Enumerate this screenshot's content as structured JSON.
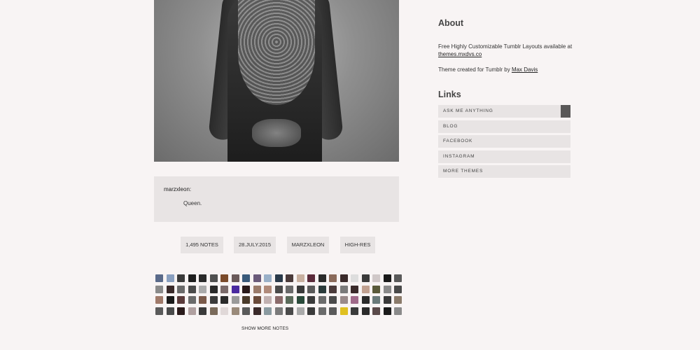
{
  "post": {
    "quote_user": "marzxleon:",
    "quote_text": "Queen."
  },
  "meta": {
    "notes": "1,495 NOTES",
    "date": "28.JULY.2015",
    "source": "MARZXLEON",
    "highres": "HIGH-RES"
  },
  "notes_section": {
    "show_more": "SHOW MORE NOTES",
    "avatar_colors": [
      "#5a6a8a",
      "#8aa0c0",
      "#3a3a3a",
      "#1e1e1e",
      "#2a2a2a",
      "#505050",
      "#7a4a2a",
      "#6a5a5a",
      "#3a5a7a",
      "#6a5a7a",
      "#9ab0c8",
      "#2a3a4a",
      "#4a3a3a",
      "#c8b0a0",
      "#5a2a3a",
      "#2a2a2a",
      "#8a6a5a",
      "#3a2a2a",
      "#dddddd",
      "#3a3a3a",
      "#d0c8c8",
      "#1a1a1a",
      "#5a5a5a",
      "#8a8a8a",
      "#3a2a2a",
      "#6a6a6a",
      "#4a4a4a",
      "#aaaaaa",
      "#2a2a2a",
      "#7a6a6a",
      "#4a2aa0",
      "#2a1a1a",
      "#9a7a6a",
      "#b08a7a",
      "#4a4a4a",
      "#6a6a6a",
      "#3a3a3a",
      "#5a5a5a",
      "#2a3a3a",
      "#4a3a3a",
      "#7a7a7a",
      "#3a2a2a",
      "#c0a090",
      "#5a5a3a",
      "#8a8a8a",
      "#4a4a4a",
      "#a07a6a",
      "#1a1a1a",
      "#5a3a3a",
      "#6a6a6a",
      "#7a5a4a",
      "#3a3a3a",
      "#2a2a2a",
      "#9a9a9a",
      "#4a3a2a",
      "#6a4a3a",
      "#c0b0b0",
      "#8a6a6a",
      "#5a6a5a",
      "#2a4a3a",
      "#3a3a3a",
      "#6a6a6a",
      "#4a4a4a",
      "#9a8a8a",
      "#a06a8a",
      "#2a2a2a",
      "#6a7a7a",
      "#3a3a3a",
      "#8a7a6a",
      "#5a5a5a",
      "#4a4a4a",
      "#2a1a1a",
      "#b0a0a0",
      "#3a3a3a",
      "#7a6a5a",
      "#e0d8d8",
      "#9a8a7a",
      "#5a5a5a",
      "#3a2a2a",
      "#8a9aa0",
      "#7a7a7a",
      "#4a4a4a",
      "#aaaaaa",
      "#3a3a3a",
      "#6a6a6a",
      "#5a5a5a",
      "#e0c020",
      "#3a3a3a",
      "#2a2a2a",
      "#5a4a4a",
      "#1a1a1a",
      "#8a8a8a"
    ]
  },
  "sidebar": {
    "about_heading": "About",
    "about_text_prefix": "Free Highly Customizable Tumblr Layouts available at ",
    "about_link": "themes.mxdvs.co",
    "credit_prefix": "Theme created for Tumblr by ",
    "credit_link": "Max Davis",
    "links_heading": "Links",
    "links": [
      {
        "label": "ASK ME ANYTHING"
      },
      {
        "label": "BLOG"
      },
      {
        "label": "FACEBOOK"
      },
      {
        "label": "INSTAGRAM"
      },
      {
        "label": "MORE THEMES"
      }
    ]
  }
}
